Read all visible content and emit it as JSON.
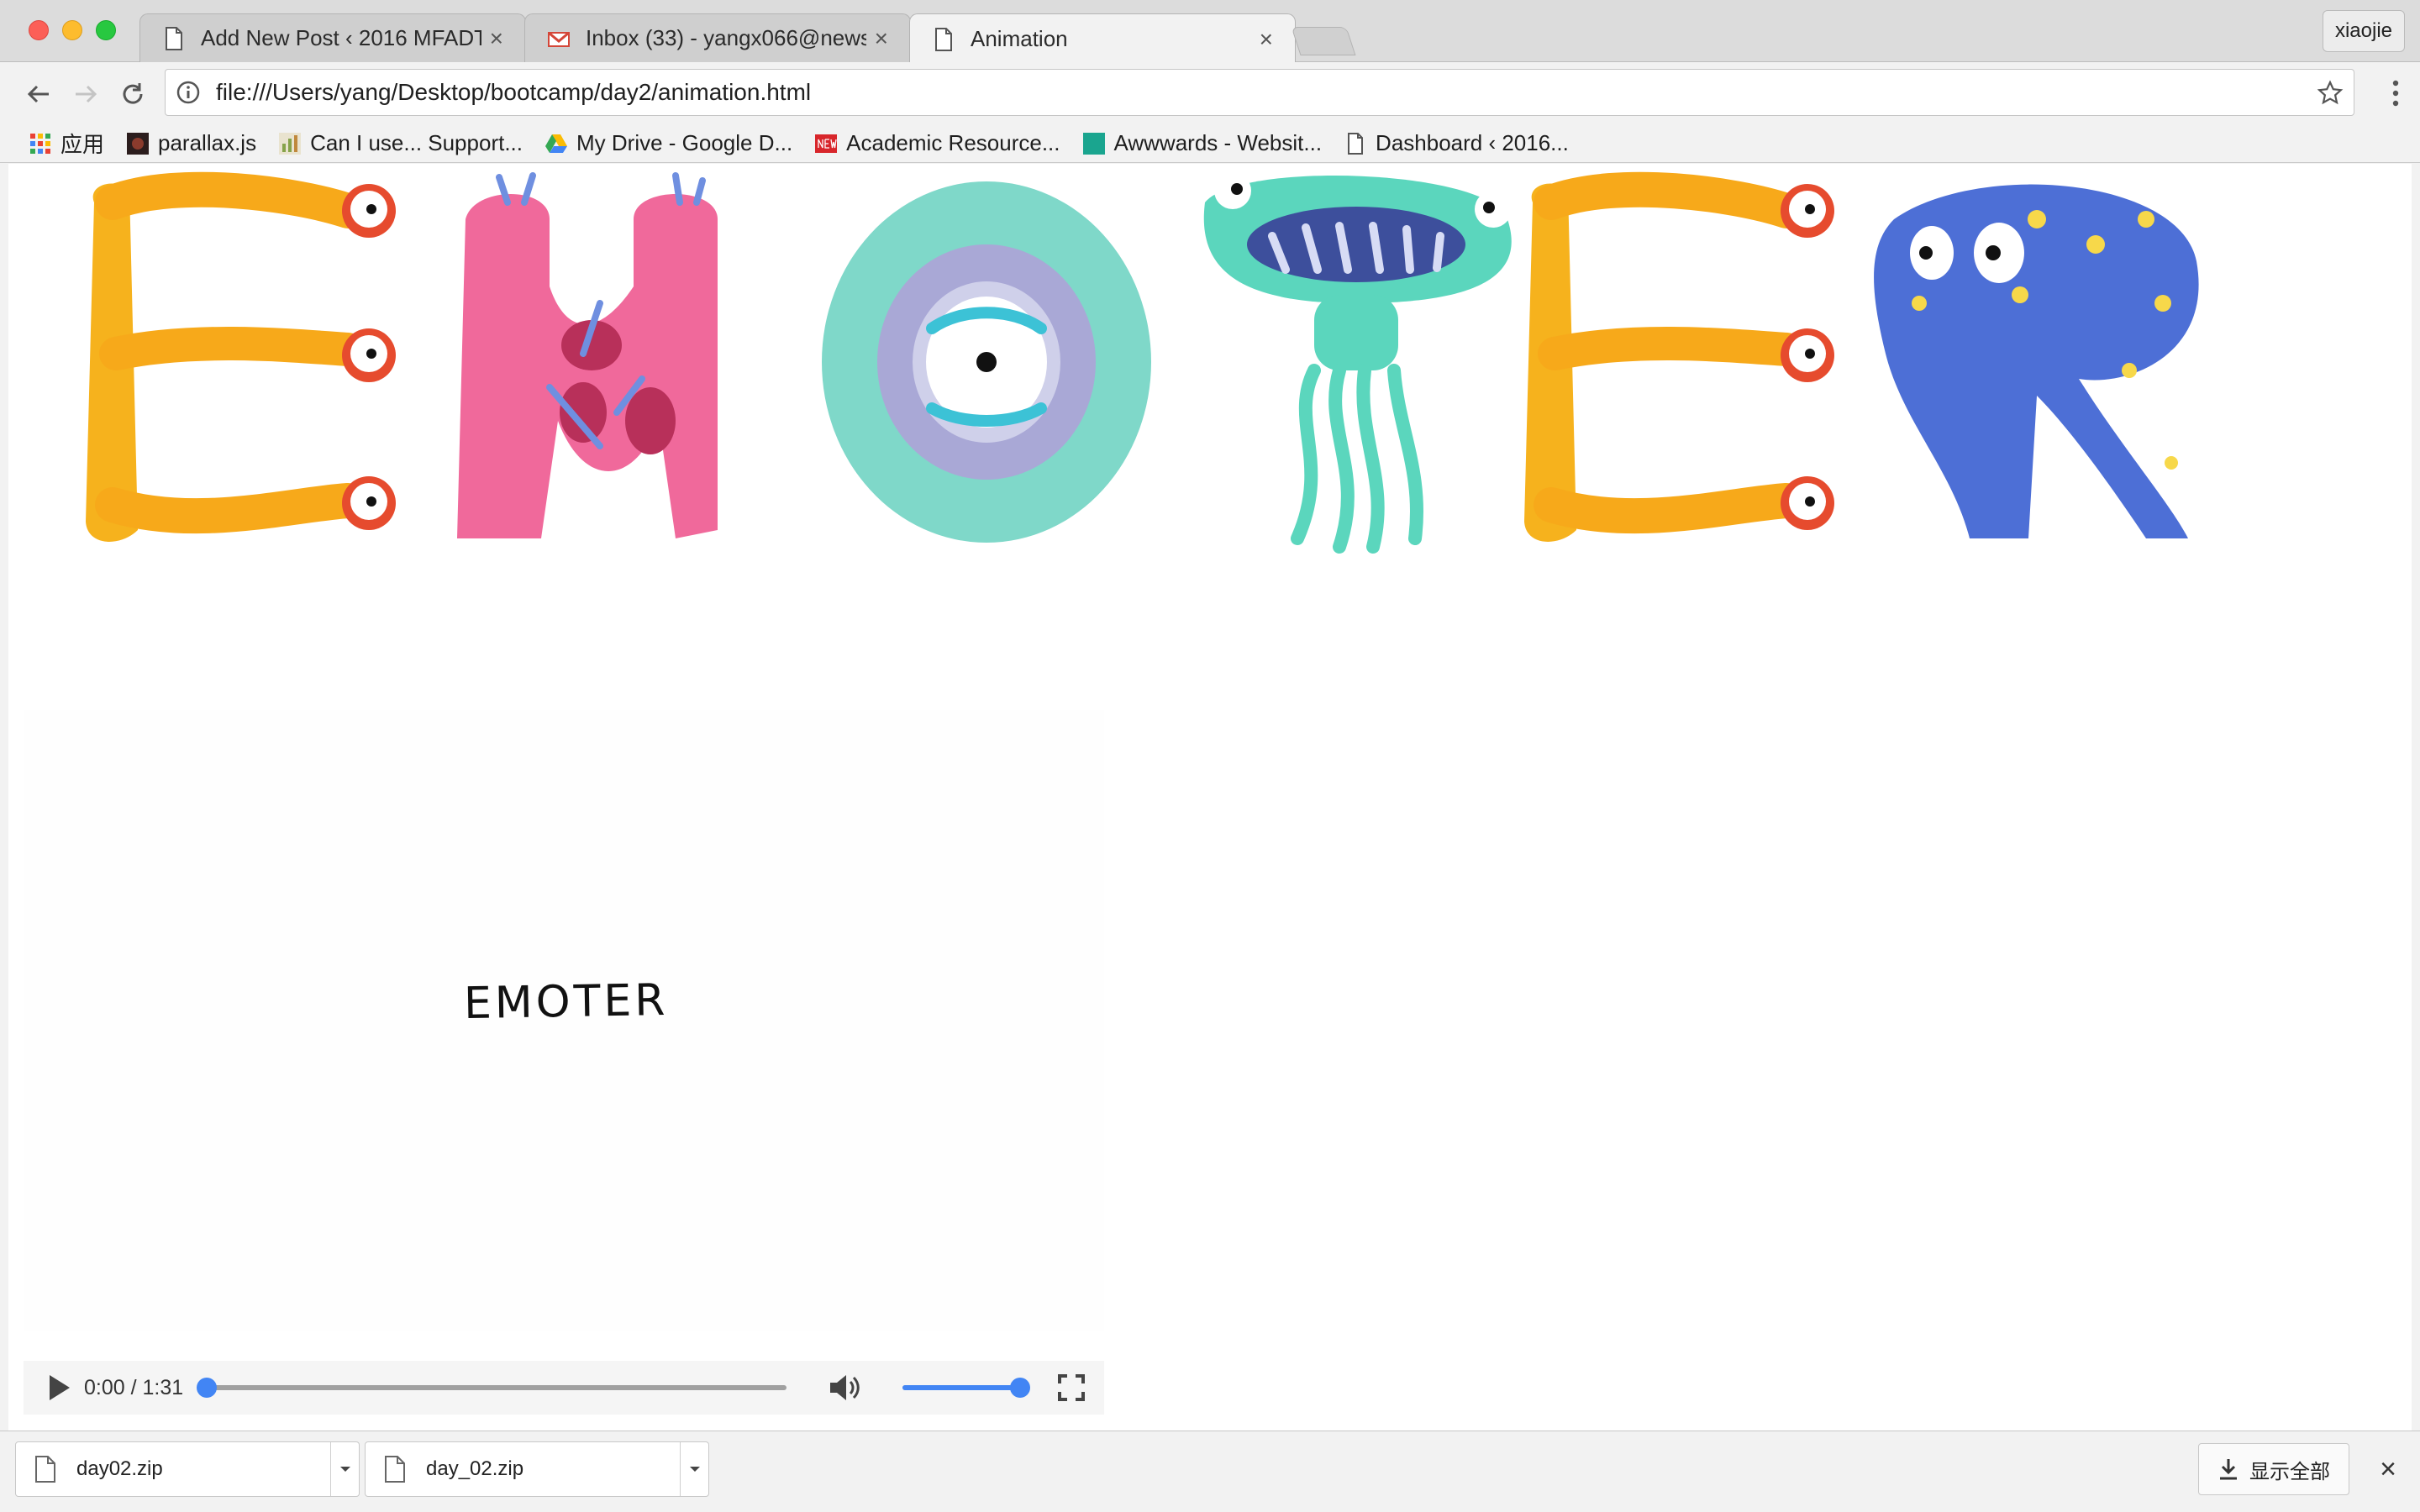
{
  "browser": {
    "tabs": [
      {
        "title": "Add New Post ‹ 2016 MFADT |",
        "icon": "page-icon"
      },
      {
        "title": "Inbox (33) - yangx066@newsc",
        "icon": "gmail-icon"
      },
      {
        "title": "Animation",
        "icon": "page-icon",
        "active": true
      }
    ],
    "tab_close": "×",
    "profile": "xiaojie",
    "url": "file:///Users/yang/Desktop/bootcamp/day2/animation.html"
  },
  "bookmarks": [
    {
      "label": "应用",
      "icon": "apps-grid-icon"
    },
    {
      "label": "parallax.js",
      "icon": "parallax-favicon"
    },
    {
      "label": "Can I use... Support...",
      "icon": "caniuse-favicon"
    },
    {
      "label": "My Drive - Google D...",
      "icon": "google-drive-icon"
    },
    {
      "label": "Academic Resource...",
      "icon": "new-badge-icon"
    },
    {
      "label": "Awwwards - Websit...",
      "icon": "awwwards-favicon"
    },
    {
      "label": "Dashboard ‹ 2016...",
      "icon": "page-icon"
    }
  ],
  "page": {
    "banner_letters": [
      "E",
      "M",
      "O",
      "T",
      "E",
      "R"
    ],
    "video": {
      "title": "EMOTER",
      "time": "0:00 / 1:31",
      "progress": 0,
      "volume": 1.0
    }
  },
  "downloads": {
    "items": [
      {
        "name": "day02.zip"
      },
      {
        "name": "day_02.zip"
      }
    ],
    "show_all": "显示全部",
    "close": "×"
  },
  "colors": {
    "accent": "#4285f4",
    "letter_e": "#f6b21d",
    "letter_m": "#f0699b",
    "letter_o": "#7fd8c9",
    "letter_t": "#5bd6bd",
    "letter_r": "#4d6fd6"
  }
}
